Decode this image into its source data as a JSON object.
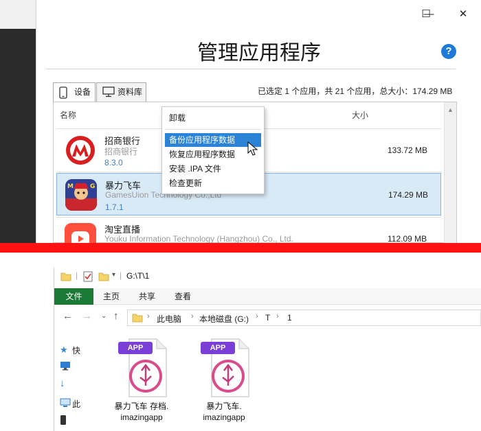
{
  "imazing": {
    "title": "管理应用程序",
    "help_icon": "question-icon",
    "window_controls": {
      "minimize": "—",
      "maximize": "☐",
      "close": "✕"
    },
    "tabs": [
      {
        "label": "设备",
        "icon": "phone-icon"
      },
      {
        "label": "资料库",
        "icon": "monitor-icon"
      }
    ],
    "selection_summary": "已选定 1 个应用，共 21 个应用，总大小：174.29 MB",
    "columns": {
      "name": "名称",
      "size": "大小"
    },
    "apps": [
      {
        "name": "招商银行",
        "vendor": "招商银行",
        "version": "8.3.0",
        "size": "133.72 MB",
        "selected": false
      },
      {
        "name": "暴力飞车",
        "vendor": "GamesUion Technology Co.,Ltd",
        "version": "1.7.1",
        "size": "174.29 MB",
        "selected": true
      },
      {
        "name": "淘宝直播",
        "vendor": "Youku Information Technology (Hangzhou) Co., Ltd.",
        "version": "",
        "size": "112.09 MB",
        "selected": false
      }
    ],
    "context_menu": {
      "items": [
        {
          "label": "卸载"
        },
        {
          "label": "备份应用程序数据",
          "highlighted": true
        },
        {
          "label": "恢复应用程序数据"
        },
        {
          "label": "安装 .IPA 文件"
        },
        {
          "label": "检查更新"
        }
      ]
    }
  },
  "explorer": {
    "quick_access_path": "G:\\T\\1",
    "ribbon_tabs": [
      "文件",
      "主页",
      "共享",
      "查看"
    ],
    "breadcrumbs": [
      "此电脑",
      "本地磁盘 (G:)",
      "T",
      "1"
    ],
    "nav_items": [
      {
        "label": "快",
        "icon": "star-icon"
      },
      {
        "label": "",
        "icon": "desktop-icon"
      },
      {
        "label": "",
        "icon": "download-icon"
      },
      {
        "label": "此",
        "icon": "pc-icon"
      },
      {
        "label": "",
        "icon": "phone-icon"
      }
    ],
    "files": [
      {
        "badge": "APP",
        "line1": "暴力飞车 存档.",
        "line2": "imazingapp"
      },
      {
        "badge": "APP",
        "line1": "暴力飞车.",
        "line2": "imazingapp"
      }
    ]
  },
  "colors": {
    "divider": "#ff1212",
    "selection_bg": "#d9eaf7",
    "menu_highlight": "#2a83d6",
    "file_tab": "#1c7a37",
    "help_blue": "#1e7ad6"
  }
}
